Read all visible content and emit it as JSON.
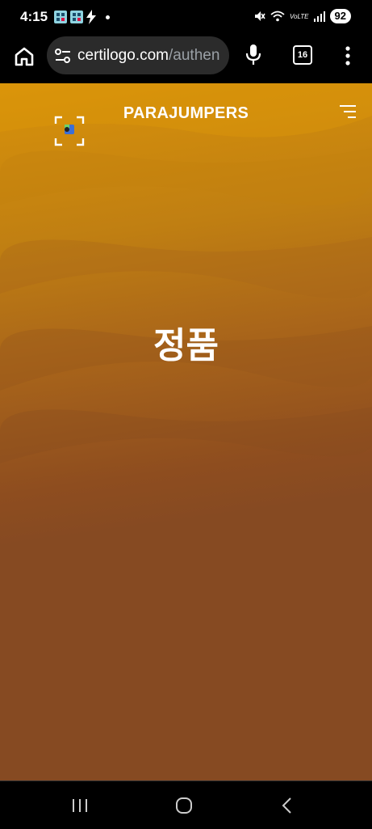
{
  "status_bar": {
    "time": "4:15",
    "battery": "92",
    "volte": "VoLTE"
  },
  "browser": {
    "url_domain": "certilogo.com",
    "url_path": "/authen",
    "tab_count": "16"
  },
  "page": {
    "brand": "PARAJUMPERS",
    "verdict": "정품",
    "colors": {
      "gradient_top": "#d8920a",
      "gradient_bottom": "#864a22"
    }
  },
  "icons": {
    "home": "home-icon",
    "site_settings": "tune-icon",
    "mic": "mic-icon",
    "tabs": "tabs-icon",
    "more": "more-vert-icon",
    "scanner": "scan-icon",
    "menu": "menu-icon",
    "nav_recent": "recent-apps-icon",
    "nav_home": "nav-home-icon",
    "nav_back": "back-icon"
  }
}
